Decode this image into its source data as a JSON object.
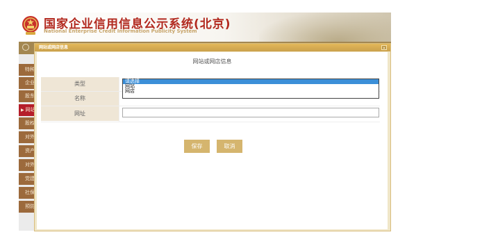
{
  "header": {
    "title_cn": "国家企业信用信息公示系统(北京)",
    "title_en": "National Enterprise Credit Information Publicity System"
  },
  "sidebar": {
    "items": [
      {
        "label": "特种"
      },
      {
        "label": "企业"
      },
      {
        "label": "股东"
      },
      {
        "label": "网站"
      },
      {
        "label": "股权"
      },
      {
        "label": "对外"
      },
      {
        "label": "资产"
      },
      {
        "label": "对外"
      },
      {
        "label": "党建"
      },
      {
        "label": "社保"
      },
      {
        "label": "预防"
      }
    ],
    "active_index": 3
  },
  "modal": {
    "title": "网站或网店信息",
    "heading": "网站或网店信息",
    "close_label": "×",
    "fields": {
      "type_label": "类型",
      "name_label": "名称",
      "url_label": "网址"
    },
    "type_options": [
      "请选择",
      "网站",
      "网店"
    ],
    "type_selected": "请选择",
    "url_value": "",
    "buttons": {
      "save": "保存",
      "cancel": "取消"
    }
  },
  "colors": {
    "brand_red": "#b2291f",
    "gold": "#d5b56e",
    "nav_brown": "#a38751",
    "selected_option": "#3b8fd8"
  }
}
